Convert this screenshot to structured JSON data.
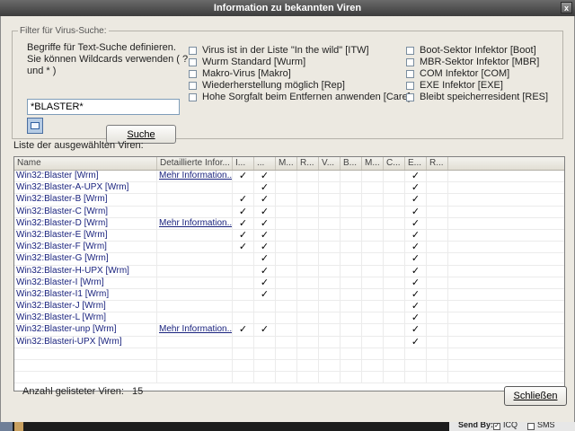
{
  "window": {
    "title": "Information zu bekannten Viren",
    "close_glyph": "x"
  },
  "filter": {
    "legend": "Filter für Virus-Suche:",
    "description": "Begriffe für Text-Suche definieren. Sie können Wildcards verwenden ( ? und * )",
    "search_value": "*BLASTER*",
    "search_button": "Suche",
    "options_col1": [
      "Virus ist in der Liste \"In the wild\" [ITW]",
      "Wurm Standard [Wurm]",
      "Makro-Virus [Makro]",
      "Wiederherstellung möglich [Rep]",
      "Hohe Sorgfalt beim Entfernen anwenden [Care]"
    ],
    "options_col2": [
      "Boot-Sektor Infektor [Boot]",
      "MBR-Sektor Infektor [MBR]",
      "COM Infektor [COM]",
      "EXE Infektor [EXE]",
      "Bleibt speicherresident [RES]"
    ]
  },
  "list": {
    "label": "Liste der ausgewählten Viren:",
    "columns": [
      "Name",
      "Detaillierte Infor...",
      "I...",
      "...",
      "M...",
      "R...",
      "V...",
      "B...",
      "M...",
      "C...",
      "E...",
      "R..."
    ],
    "rows": [
      {
        "name": "Win32:Blaster [Wrm]",
        "detail": "Mehr Information...",
        "flags": [
          "✓",
          "✓",
          "",
          "",
          "",
          "",
          "",
          "",
          "✓",
          ""
        ]
      },
      {
        "name": "Win32:Blaster-A-UPX [Wrm]",
        "detail": "",
        "flags": [
          "",
          "✓",
          "",
          "",
          "",
          "",
          "",
          "",
          "✓",
          ""
        ]
      },
      {
        "name": "Win32:Blaster-B [Wrm]",
        "detail": "",
        "flags": [
          "✓",
          "✓",
          "",
          "",
          "",
          "",
          "",
          "",
          "✓",
          ""
        ]
      },
      {
        "name": "Win32:Blaster-C [Wrm]",
        "detail": "",
        "flags": [
          "✓",
          "✓",
          "",
          "",
          "",
          "",
          "",
          "",
          "✓",
          ""
        ]
      },
      {
        "name": "Win32:Blaster-D [Wrm]",
        "detail": "Mehr Information...",
        "flags": [
          "✓",
          "✓",
          "",
          "",
          "",
          "",
          "",
          "",
          "✓",
          ""
        ]
      },
      {
        "name": "Win32:Blaster-E [Wrm]",
        "detail": "",
        "flags": [
          "✓",
          "✓",
          "",
          "",
          "",
          "",
          "",
          "",
          "✓",
          ""
        ]
      },
      {
        "name": "Win32:Blaster-F [Wrm]",
        "detail": "",
        "flags": [
          "✓",
          "✓",
          "",
          "",
          "",
          "",
          "",
          "",
          "✓",
          ""
        ]
      },
      {
        "name": "Win32:Blaster-G [Wrm]",
        "detail": "",
        "flags": [
          "",
          "✓",
          "",
          "",
          "",
          "",
          "",
          "",
          "✓",
          ""
        ]
      },
      {
        "name": "Win32:Blaster-H-UPX [Wrm]",
        "detail": "",
        "flags": [
          "",
          "✓",
          "",
          "",
          "",
          "",
          "",
          "",
          "✓",
          ""
        ]
      },
      {
        "name": "Win32:Blaster-I [Wrm]",
        "detail": "",
        "flags": [
          "",
          "✓",
          "",
          "",
          "",
          "",
          "",
          "",
          "✓",
          ""
        ]
      },
      {
        "name": "Win32:Blaster-I1 [Wrm]",
        "detail": "",
        "flags": [
          "",
          "✓",
          "",
          "",
          "",
          "",
          "",
          "",
          "✓",
          ""
        ]
      },
      {
        "name": "Win32:Blaster-J [Wrm]",
        "detail": "",
        "flags": [
          "",
          "",
          "",
          "",
          "",
          "",
          "",
          "",
          "✓",
          ""
        ]
      },
      {
        "name": "Win32:Blaster-L [Wrm]",
        "detail": "",
        "flags": [
          "",
          "",
          "",
          "",
          "",
          "",
          "",
          "",
          "✓",
          ""
        ]
      },
      {
        "name": "Win32:Blaster-unp [Wrm]",
        "detail": "Mehr Information...",
        "flags": [
          "✓",
          "✓",
          "",
          "",
          "",
          "",
          "",
          "",
          "✓",
          ""
        ]
      },
      {
        "name": "Win32:Blasteri-UPX [Wrm]",
        "detail": "",
        "flags": [
          "",
          "",
          "",
          "",
          "",
          "",
          "",
          "",
          "✓",
          ""
        ]
      }
    ]
  },
  "footer": {
    "count_label": "Anzahl gelisteter Viren:",
    "count_value": "15",
    "close_button": "Schließen"
  },
  "taskbar": {
    "send_by": "Send By:",
    "icq_label": "ICQ",
    "sms_label": "SMS",
    "icq_checked": "✓"
  }
}
